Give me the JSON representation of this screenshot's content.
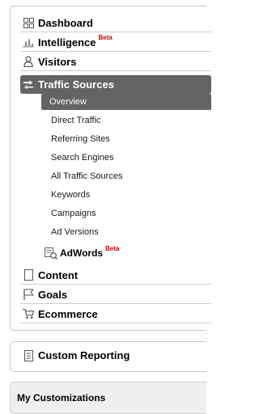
{
  "nav": {
    "dashboard": "Dashboard",
    "intelligence": "Intelligence",
    "intelligence_badge": "Beta",
    "visitors": "Visitors",
    "traffic_sources": "Traffic Sources",
    "traffic_sub": [
      "Overview",
      "Direct Traffic",
      "Referring Sites",
      "Search Engines",
      "All Traffic Sources",
      "Keywords",
      "Campaigns",
      "Ad Versions"
    ],
    "adwords": "AdWords",
    "adwords_badge": "Beta",
    "content": "Content",
    "goals": "Goals",
    "ecommerce": "Ecommerce"
  },
  "custom_reporting": {
    "label": "Custom Reporting"
  },
  "my_customizations": {
    "title": "My Customizations"
  },
  "colors": {
    "active_bg": "#646464",
    "active_text": "#ffffff",
    "beta_red": "#cc0000",
    "divider": "#cdcdcd"
  },
  "icons": {
    "dashboard": "grid-icon",
    "intelligence": "pulse-icon",
    "visitors": "person-icon",
    "traffic_sources": "traffic-arrows-icon",
    "adwords": "adwords-icon",
    "content": "page-icon",
    "goals": "flag-icon",
    "ecommerce": "cart-icon",
    "custom_reporting": "report-icon"
  }
}
